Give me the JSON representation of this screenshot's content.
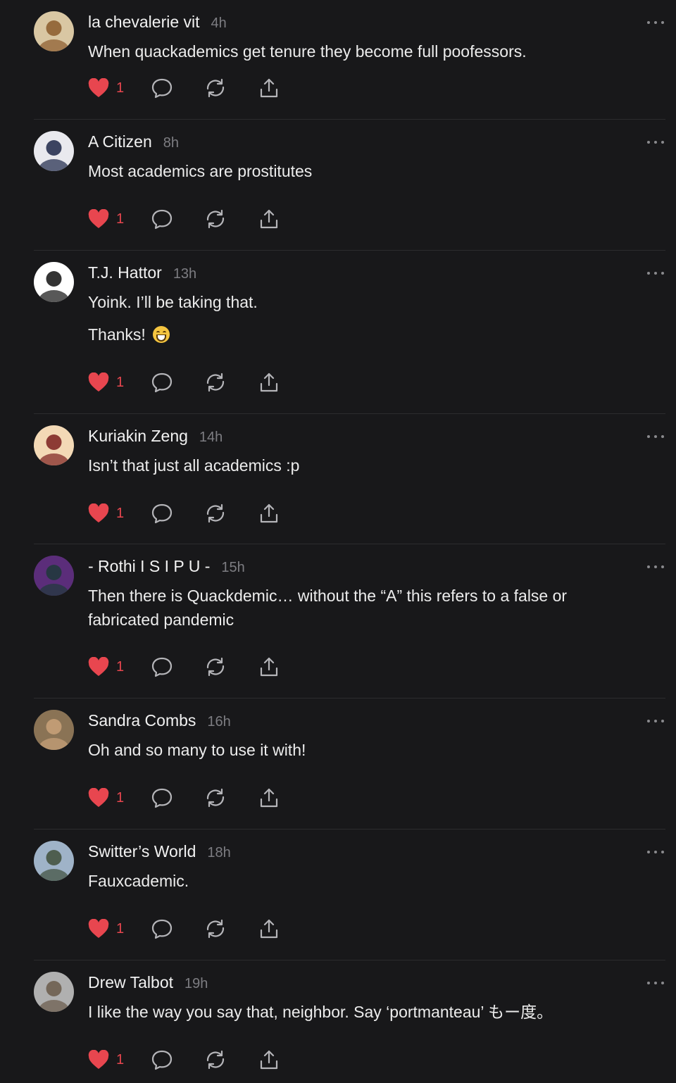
{
  "comments": [
    {
      "name": "la chevalerie vit",
      "time": "4h",
      "text": [
        "When quackademics get tenure they become full poofessors."
      ],
      "likes": "1",
      "avatar_colors": [
        "#d9c7a3",
        "#8a5a2b"
      ]
    },
    {
      "name": "A Citizen",
      "time": "8h",
      "text": [
        "Most academics are prostitutes"
      ],
      "likes": "1",
      "avatar_colors": [
        "#e9e9ee",
        "#1d2748"
      ]
    },
    {
      "name": "T.J. Hattor",
      "time": "13h",
      "text": [
        "Yoink. I’ll be taking that.",
        "Thanks!"
      ],
      "emoji_after_last": true,
      "likes": "1",
      "avatar_colors": [
        "#ffffff",
        "#111111"
      ]
    },
    {
      "name": "Kuriakin Zeng",
      "time": "14h",
      "text": [
        "Isn’t that just all academics :p"
      ],
      "likes": "1",
      "avatar_colors": [
        "#f3d9b6",
        "#7a1e1e"
      ]
    },
    {
      "name": "- Rothi I S I P U -",
      "time": "15h",
      "text": [
        "Then there is Quackdemic… without the “A” this refers to a false or fabricated pandemic"
      ],
      "likes": "1",
      "avatar_colors": [
        "#5b2d7a",
        "#1e3a3a"
      ]
    },
    {
      "name": "Sandra Combs",
      "time": "16h",
      "text": [
        "Oh and so many to use it with!"
      ],
      "likes": "1",
      "avatar_colors": [
        "#8a7355",
        "#c9a27a"
      ]
    },
    {
      "name": "Switter’s World",
      "time": "18h",
      "text": [
        "Fauxcademic."
      ],
      "likes": "1",
      "avatar_colors": [
        "#9fb3c8",
        "#3f4f3a"
      ]
    },
    {
      "name": "Drew Talbot",
      "time": "19h",
      "text": [
        "I like the way you say that, neighbor. Say ‘portmanteau’ もー度。"
      ],
      "likes": "1",
      "avatar_colors": [
        "#b0b0b0",
        "#6a5a4a"
      ]
    }
  ],
  "icons": {
    "like": "heart-icon",
    "reply": "comment-icon",
    "repost": "repost-icon",
    "share": "share-icon",
    "more": "more-icon"
  },
  "colors": {
    "background": "#18181a",
    "like_accent": "#e8464f",
    "muted": "#7d7d82"
  }
}
